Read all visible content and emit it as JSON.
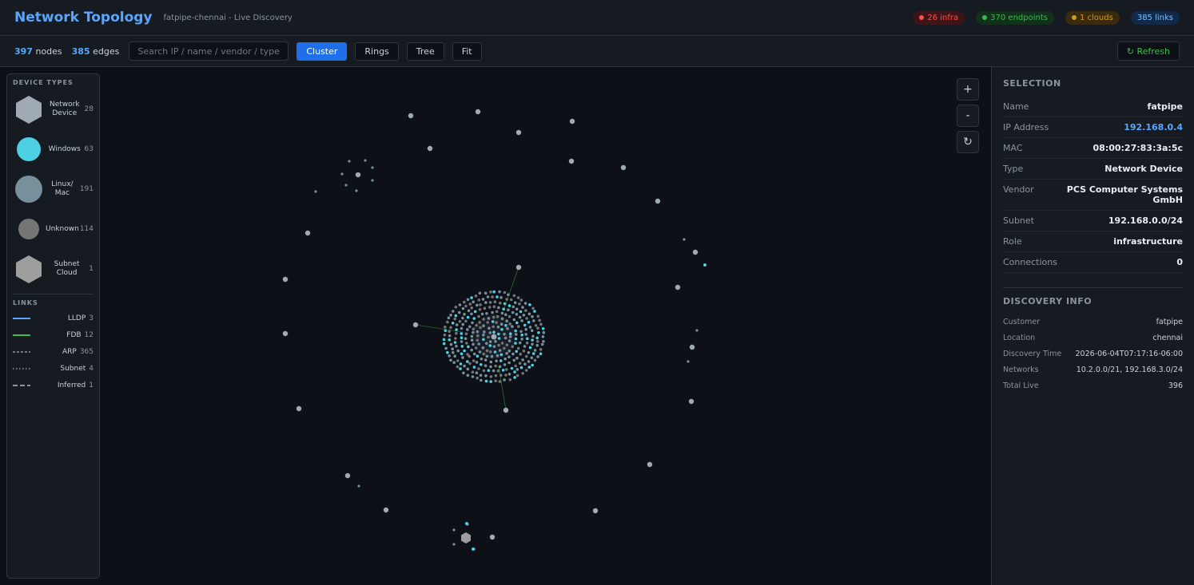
{
  "header": {
    "title": "Network Topology",
    "subtitle": "fatpipe-chennai - Live Discovery",
    "badges": [
      {
        "label": "26 infra",
        "bg": "#3d1418",
        "fg": "#f85149",
        "dot": "#f85149"
      },
      {
        "label": "370 endpoints",
        "bg": "#12301c",
        "fg": "#3fb950",
        "dot": "#3fb950"
      },
      {
        "label": "1 clouds",
        "bg": "#3a2a10",
        "fg": "#d29922",
        "dot": "#d29922"
      },
      {
        "label": "385 links",
        "bg": "#13294a",
        "fg": "#79c0ff",
        "dot": ""
      }
    ]
  },
  "toolbar": {
    "nodes_count": "397",
    "nodes_label": "nodes",
    "edges_count": "385",
    "edges_label": "edges",
    "search_placeholder": "Search IP / name / vendor / type...",
    "buttons": [
      "Cluster",
      "Rings",
      "Tree",
      "Fit"
    ],
    "active": "Cluster",
    "refresh": "↻ Refresh"
  },
  "legend": {
    "device_types_title": "DEVICE TYPES",
    "device_types": [
      {
        "label": "Network Device",
        "count": "28",
        "shape": "hexagon",
        "color": "#a0aab4"
      },
      {
        "label": "Windows",
        "count": "63",
        "shape": "circle",
        "color": "#4dd0e1"
      },
      {
        "label": "Linux/ Mac",
        "count": "191",
        "shape": "circle",
        "color": "#78909c"
      },
      {
        "label": "Unknown",
        "count": "114",
        "shape": "circle",
        "color": "#757575"
      },
      {
        "label": "Subnet Cloud",
        "count": "1",
        "shape": "hexagon",
        "color": "#9e9e9e"
      }
    ],
    "links_title": "LINKS",
    "links": [
      {
        "label": "LLDP",
        "count": "3",
        "color": "#58a6ff",
        "style": "solid"
      },
      {
        "label": "FDB",
        "count": "12",
        "color": "#3fb950",
        "style": "solid"
      },
      {
        "label": "ARP",
        "count": "365",
        "color": "#6e7681",
        "style": "dashed"
      },
      {
        "label": "Subnet",
        "count": "4",
        "color": "#6e7681",
        "style": "dotted"
      },
      {
        "label": "Inferred",
        "count": "1",
        "color": "#8b949e",
        "style": "longdash"
      }
    ]
  },
  "zoom": {
    "in": "+",
    "out": "-",
    "reset": "↻"
  },
  "selection": {
    "title": "SELECTION",
    "rows": [
      {
        "k": "Name",
        "v": "fatpipe"
      },
      {
        "k": "IP Address",
        "v": "192.168.0.4",
        "link": true
      },
      {
        "k": "MAC",
        "v": "08:00:27:83:3a:5c"
      },
      {
        "k": "Type",
        "v": "Network Device"
      },
      {
        "k": "Vendor",
        "v": "PCS Computer Systems GmbH"
      },
      {
        "k": "Subnet",
        "v": "192.168.0.0/24"
      },
      {
        "k": "Role",
        "v": "infrastructure"
      },
      {
        "k": "Connections",
        "v": "0"
      }
    ]
  },
  "discovery": {
    "title": "DISCOVERY INFO",
    "rows": [
      {
        "k": "Customer",
        "v": "fatpipe"
      },
      {
        "k": "Location",
        "v": "chennai"
      },
      {
        "k": "Discovery Time",
        "v": "2026-06-04T07:17:16-06:00"
      },
      {
        "k": "Networks",
        "v": "10.2.0.0/21, 192.168.3.0/24"
      },
      {
        "k": "Total Live",
        "v": "396"
      }
    ]
  },
  "colors": {
    "infra": "#a0aab4",
    "windows": "#4dd0e1",
    "linux": "#78909c",
    "unknown": "#757575"
  }
}
